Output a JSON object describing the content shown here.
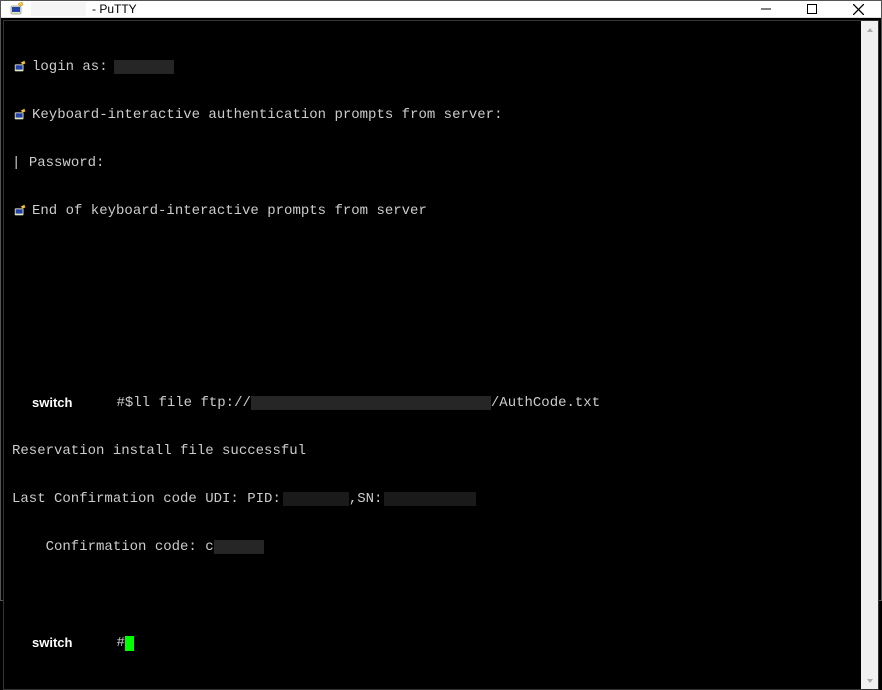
{
  "window": {
    "title_suffix": " - PuTTY"
  },
  "terminal": {
    "lines": {
      "login": "login as:",
      "kbd_interactive": "Keyboard-interactive authentication prompts from server:",
      "password_prefix": "| ",
      "password": "Password:",
      "end_prompts": "End of keyboard-interactive prompts from server",
      "prompt_host": "switch",
      "cmd_prefix": "#$ll file ftp://",
      "cmd_suffix": "/AuthCode.txt",
      "reservation": "Reservation install file successful",
      "last_conf_prefix": "Last Confirmation code UDI: PID:",
      "last_conf_mid": ",SN:",
      "conf_code_prefix": "    Confirmation code: c",
      "cursor_prefix": "#"
    }
  }
}
